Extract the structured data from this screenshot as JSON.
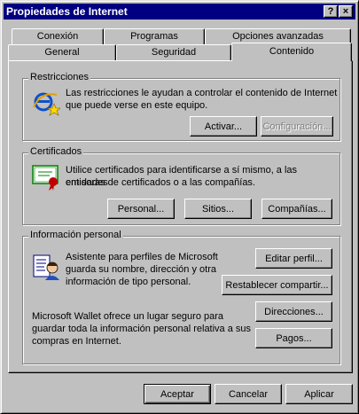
{
  "window": {
    "title": "Propiedades de Internet",
    "help_label": "?",
    "close_label": "×"
  },
  "tabs": {
    "row_back": [
      "Conexión",
      "Programas",
      "Opciones avanzadas"
    ],
    "row_front": [
      "General",
      "Seguridad",
      "Contenido"
    ],
    "active": "Contenido"
  },
  "restricciones": {
    "label": "Restricciones",
    "text_line1": "Las restricciones le ayudan a controlar el contenido de Internet",
    "text_line2": "que puede verse en este equipo.",
    "activar_label": "Activar...",
    "configuracion_label": "Configuración...",
    "icon": "content-advisor-icon"
  },
  "certificados": {
    "label": "Certificados",
    "text_line1": "Utilice certificados para identificarse a sí mismo, a las entidades",
    "text_line2": "emisoras de certificados o a las compañías.",
    "personal_label": "Personal...",
    "sitios_label": "Sitios...",
    "companias_label": "Compañías...",
    "icon": "certificate-icon"
  },
  "info_personal": {
    "label": "Información personal",
    "text_line1": "Asistente para perfiles de Microsoft",
    "text_line2": "guarda su nombre, dirección y otra",
    "text_line3": "información de tipo personal.",
    "editar_label": "Editar perfil...",
    "restablecer_label": "Restablecer compartir...",
    "wallet_line1": "Microsoft Wallet ofrece un lugar seguro para",
    "wallet_line2": "guardar toda la información personal relativa a sus",
    "wallet_line3": "compras en Internet.",
    "direcciones_label": "Direcciones...",
    "pagos_label": "Pagos...",
    "icon": "profile-assistant-icon"
  },
  "footer": {
    "aceptar_label": "Aceptar",
    "cancelar_label": "Cancelar",
    "aplicar_label": "Aplicar"
  },
  "colors": {
    "titlebar": "#000080",
    "face": "#c0c0c0",
    "disabled_text": "#808080"
  }
}
